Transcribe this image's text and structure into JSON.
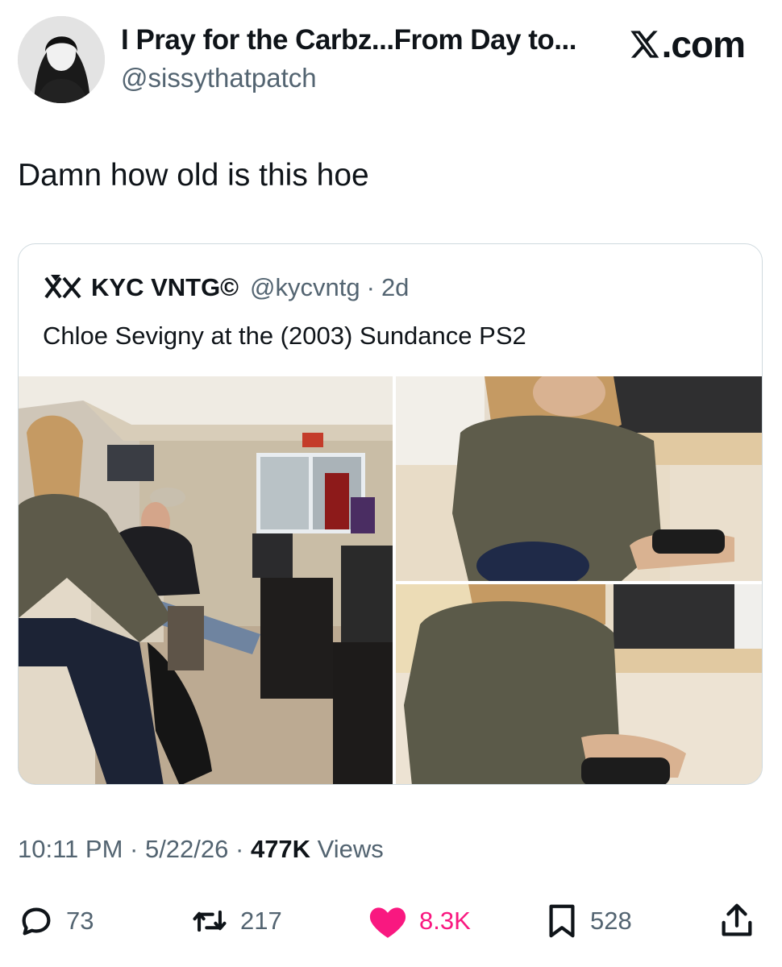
{
  "post": {
    "display_name": "I Pray for the Carbz...From Day to...",
    "handle": "@sissythatpatch",
    "source_label": ".com",
    "text": "Damn how old is this hoe"
  },
  "quoted": {
    "name": "KYC VNTG©",
    "handle": "@kycvntg",
    "separator": "·",
    "age": "2d",
    "text": "Chloe Sevigny at the (2003) Sundance PS2",
    "photos": [
      {
        "description": "woman playing video game in tent lounge"
      },
      {
        "description": "woman in turtleneck holding controller"
      },
      {
        "description": "close-up holding controller"
      }
    ]
  },
  "meta": {
    "time": "10:11 PM",
    "sep1": " · ",
    "date": "5/22/26",
    "sep2": " · ",
    "views_count": "477K",
    "views_label": " Views"
  },
  "actions": {
    "replies": "73",
    "reposts": "217",
    "likes": "8.3K",
    "bookmarks": "528"
  },
  "colors": {
    "like_pink": "#f91880",
    "secondary_text": "#536471",
    "border": "#cfd9de"
  }
}
